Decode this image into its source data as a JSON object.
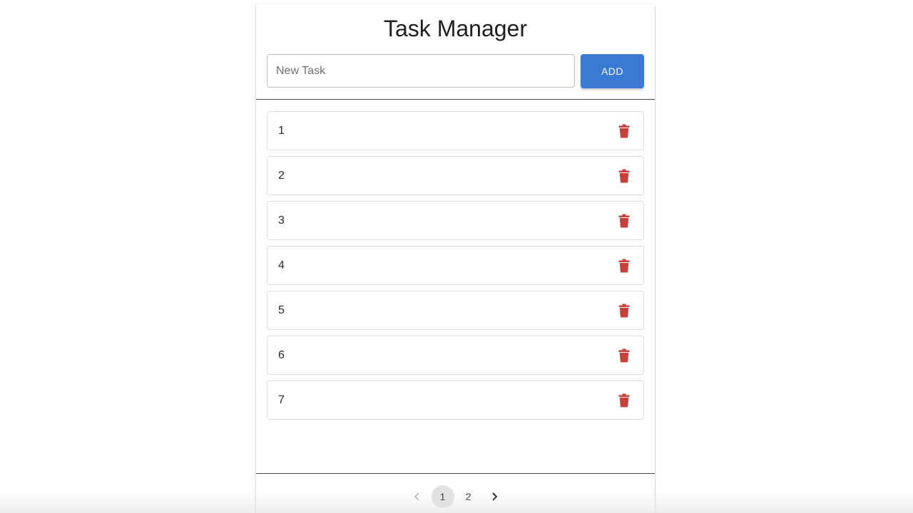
{
  "header": {
    "title": "Task Manager"
  },
  "new_task": {
    "placeholder": "New Task",
    "value": "",
    "add_label": "ADD"
  },
  "tasks": [
    {
      "label": "1",
      "delete_icon": "trash-icon"
    },
    {
      "label": "2",
      "delete_icon": "trash-icon"
    },
    {
      "label": "3",
      "delete_icon": "trash-icon"
    },
    {
      "label": "4",
      "delete_icon": "trash-icon"
    },
    {
      "label": "5",
      "delete_icon": "trash-icon"
    },
    {
      "label": "6",
      "delete_icon": "trash-icon"
    },
    {
      "label": "7",
      "delete_icon": "trash-icon"
    }
  ],
  "pagination": {
    "prev_icon": "chevron-left-icon",
    "next_icon": "chevron-right-icon",
    "pages": [
      "1",
      "2"
    ],
    "current": "1"
  },
  "colors": {
    "accent": "#3b7ad4",
    "delete": "#c9403a",
    "prev_disabled": "#b5b5b5",
    "next_enabled": "#1f1f1f"
  }
}
